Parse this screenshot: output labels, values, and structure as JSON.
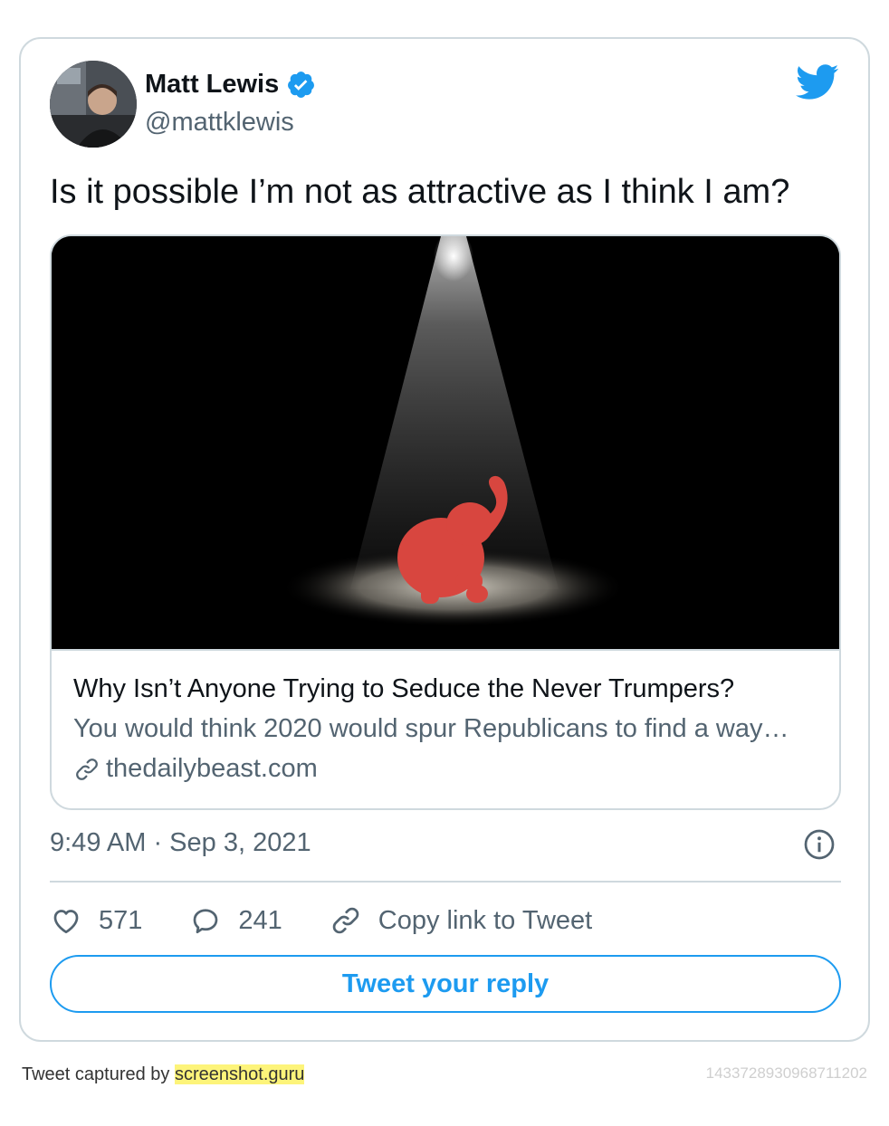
{
  "tweet": {
    "author_name": "Matt Lewis",
    "handle": "@mattklewis",
    "text": "Is it possible I’m not as attractive as I think I am?",
    "timestamp": "9:49 AM · Sep 3, 2021",
    "likes": "571",
    "replies": "241",
    "copy_link_label": "Copy link to Tweet",
    "reply_button_label": "Tweet your reply"
  },
  "link_card": {
    "title": "Why Isn’t Anyone Trying to Seduce the Never Trumpers?",
    "description": "You would think 2020 would spur Republicans to find a way…",
    "domain": "thedailybeast.com"
  },
  "footer": {
    "captured_prefix": "Tweet captured by ",
    "brand": "screenshot.guru",
    "tweet_id": "1433728930968711202"
  },
  "colors": {
    "accent": "#1d9bf0",
    "secondary_text": "#536471",
    "border": "#cfd9de"
  },
  "icons": [
    "verified-badge-icon",
    "twitter-bird-icon",
    "link-icon",
    "info-icon",
    "heart-icon",
    "reply-bubble-icon",
    "copy-link-icon"
  ]
}
